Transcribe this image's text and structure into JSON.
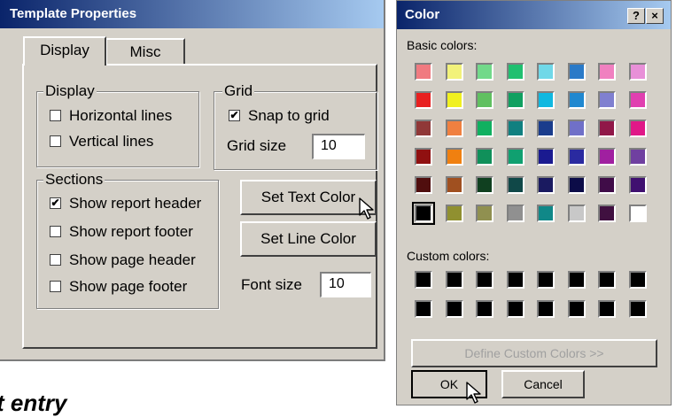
{
  "template_dialog": {
    "title": "Template Properties",
    "tabs": [
      "Display",
      "Misc"
    ],
    "display_group": {
      "label": "Display",
      "items": [
        {
          "label": "Horizontal lines",
          "checked": false
        },
        {
          "label": "Vertical lines",
          "checked": false
        }
      ]
    },
    "grid_group": {
      "label": "Grid",
      "snap_label": "Snap to grid",
      "snap_checked": true,
      "size_label": "Grid size",
      "size_value": "10"
    },
    "sections_group": {
      "label": "Sections",
      "items": [
        {
          "label": "Show report header",
          "checked": true
        },
        {
          "label": "Show report footer",
          "checked": false
        },
        {
          "label": "Show page header",
          "checked": false
        },
        {
          "label": "Show page footer",
          "checked": false
        }
      ]
    },
    "set_text_color_label": "Set Text Color",
    "set_line_color_label": "Set Line Color",
    "font_size_label": "Font size",
    "font_size_value": "10",
    "checkmark": "✔"
  },
  "caption": "t entry",
  "color_dialog": {
    "title": "Color",
    "help_label": "?",
    "close_label": "×",
    "basic_label": "Basic colors:",
    "custom_label": "Custom colors:",
    "define_label": "Define Custom Colors >>",
    "ok_label": "OK",
    "cancel_label": "Cancel",
    "selected_index": 40,
    "basic_colors": [
      "#f07a80",
      "#f2f27a",
      "#72d98a",
      "#20c070",
      "#70d8e8",
      "#2a7ac8",
      "#f080c0",
      "#e890d8",
      "#e82020",
      "#f0f020",
      "#60c060",
      "#10a060",
      "#10b8e0",
      "#2088d0",
      "#8080d0",
      "#e040b0",
      "#903838",
      "#f08040",
      "#10b060",
      "#108080",
      "#1a3c8c",
      "#7070c8",
      "#901848",
      "#e01888",
      "#901010",
      "#f08010",
      "#10905a",
      "#10a070",
      "#1a1a90",
      "#2a2aa0",
      "#a020a0",
      "#7040a0",
      "#500e0e",
      "#a05020",
      "#104020",
      "#104848",
      "#1a1a60",
      "#0c0c48",
      "#400c48",
      "#401070",
      "#000000",
      "#909030",
      "#909050",
      "#909090",
      "#108888",
      "#c8c8c8",
      "#401040",
      "#ffffff"
    ],
    "custom_colors": [
      "#000000",
      "#000000",
      "#000000",
      "#000000",
      "#000000",
      "#000000",
      "#000000",
      "#000000",
      "#000000",
      "#000000",
      "#000000",
      "#000000",
      "#000000",
      "#000000",
      "#000000",
      "#000000"
    ]
  }
}
